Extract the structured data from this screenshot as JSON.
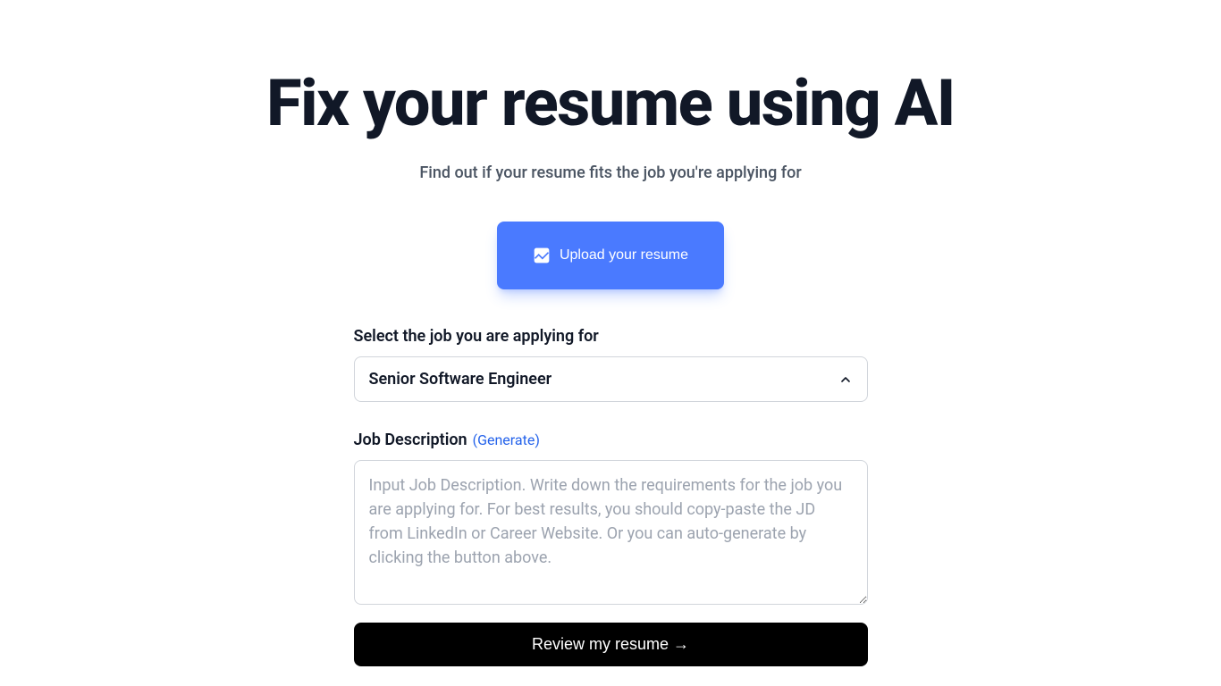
{
  "hero": {
    "title": "Fix your resume using AI",
    "subtitle": "Find out if your resume fits the job you're applying for"
  },
  "upload": {
    "label": "Upload your resume"
  },
  "jobSelect": {
    "label": "Select the job you are applying for",
    "value": "Senior Software Engineer"
  },
  "jobDescription": {
    "label": "Job Description",
    "generateLabel": "(Generate)",
    "placeholder": "Input Job Description. Write down the requirements for the job you are applying for. For best results, you should copy-paste the JD from LinkedIn or Career Website. Or you can auto-generate by clicking the button above.",
    "value": ""
  },
  "review": {
    "label": "Review my resume →"
  }
}
